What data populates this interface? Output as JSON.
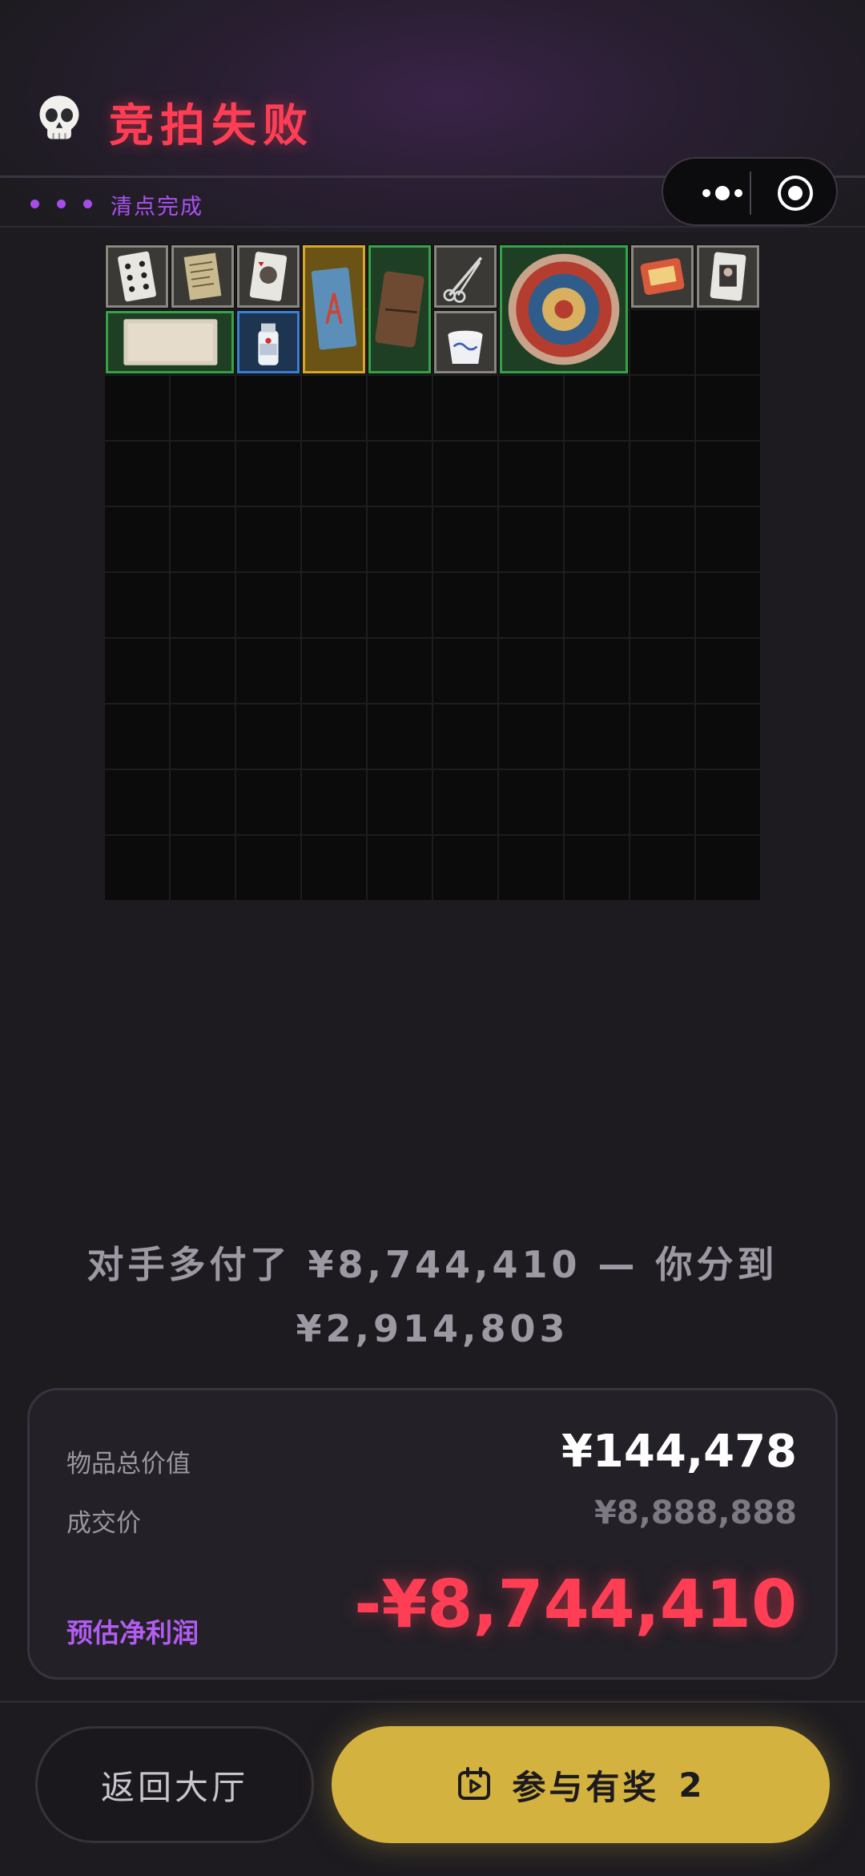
{
  "header": {
    "title": "竞拍失败",
    "status": "清点完成",
    "skull_icon": "skull-icon"
  },
  "capsule": {
    "more_icon": "more-dots-icon",
    "close_icon": "target-close-icon"
  },
  "inventory": {
    "columns": 10,
    "rows": 10,
    "items": [
      {
        "name": "playing-card-spades",
        "tier": "gray",
        "col": 0,
        "row": 0,
        "w": 1,
        "h": 1
      },
      {
        "name": "old-document",
        "tier": "gray",
        "col": 1,
        "row": 0,
        "w": 1,
        "h": 1
      },
      {
        "name": "playing-card-portrait",
        "tier": "gray",
        "col": 2,
        "row": 0,
        "w": 1,
        "h": 1
      },
      {
        "name": "blue-book",
        "tier": "gold",
        "col": 3,
        "row": 0,
        "w": 1,
        "h": 2
      },
      {
        "name": "leather-journal",
        "tier": "green",
        "col": 4,
        "row": 0,
        "w": 1,
        "h": 2
      },
      {
        "name": "scissors",
        "tier": "gray",
        "col": 5,
        "row": 0,
        "w": 1,
        "h": 1
      },
      {
        "name": "decorated-plate",
        "tier": "green",
        "col": 6,
        "row": 0,
        "w": 2,
        "h": 2
      },
      {
        "name": "food-package",
        "tier": "gray",
        "col": 8,
        "row": 0,
        "w": 1,
        "h": 1
      },
      {
        "name": "playing-card-face",
        "tier": "gray",
        "col": 9,
        "row": 0,
        "w": 1,
        "h": 1
      },
      {
        "name": "parchment",
        "tier": "green",
        "col": 0,
        "row": 1,
        "w": 2,
        "h": 1
      },
      {
        "name": "medicine-bottle",
        "tier": "blue",
        "col": 2,
        "row": 1,
        "w": 1,
        "h": 1
      },
      {
        "name": "yogurt-cup",
        "tier": "gray",
        "col": 5,
        "row": 1,
        "w": 1,
        "h": 1
      }
    ]
  },
  "summary": {
    "line1": "对手多付了 ¥8,744,410 — 你分到",
    "line2": "¥2,914,803"
  },
  "card": {
    "total_label": "物品总价值",
    "total_value": "¥144,478",
    "deal_label": "成交价",
    "deal_value": "¥8,888,888",
    "profit_label": "预估净利润",
    "profit_value": "-¥8,744,410"
  },
  "buttons": {
    "back_label": "返回大厅",
    "join_label": "参与有奖",
    "join_count": "2"
  },
  "colors": {
    "accent_red": "#ff3e55",
    "accent_purple": "#b25cf2",
    "gold_button": "#d4b23f",
    "tier_green": "#37a14a",
    "tier_gold": "#d7a729",
    "tier_blue": "#3b7fd3",
    "tier_gray": "#8a8780"
  }
}
